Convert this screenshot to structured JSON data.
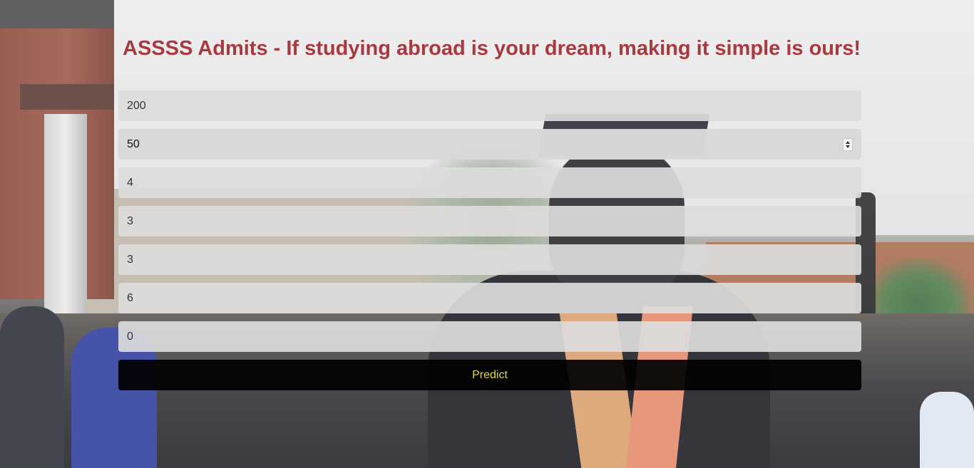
{
  "page": {
    "title": "ASSSS Admits - If studying abroad is your dream, making it simple is ours!"
  },
  "form": {
    "fields": [
      {
        "value": "200"
      },
      {
        "value": "50"
      },
      {
        "value": "4"
      },
      {
        "value": "3"
      },
      {
        "value": "3"
      },
      {
        "value": "6"
      },
      {
        "value": "0"
      }
    ],
    "predict_label": "Predict"
  },
  "colors": {
    "title": "#a83a3f",
    "button_bg": "#000000",
    "button_text": "#e3d84a",
    "field_bg": "#dcdcdc"
  },
  "icons": {
    "number_spinner": "spinner-arrows"
  }
}
